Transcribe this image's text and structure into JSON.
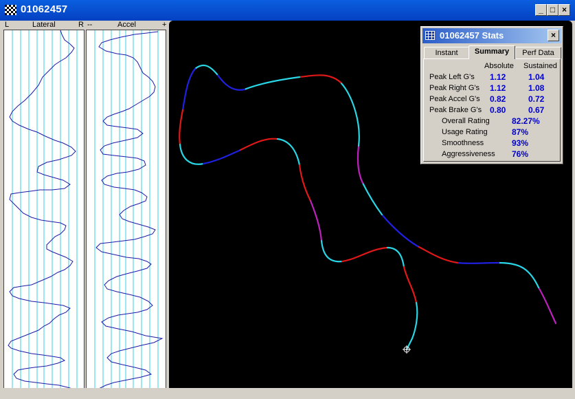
{
  "window": {
    "title": "01062457",
    "minimize_label": "_",
    "maximize_label": "□",
    "close_label": "×"
  },
  "strips": {
    "lateral": {
      "left_label": "L",
      "title": "Lateral",
      "right_label": "R"
    },
    "accel": {
      "left_label": "--",
      "title": "Accel",
      "right_label": "+"
    }
  },
  "stats": {
    "title": "01062457 Stats",
    "close_label": "×",
    "tabs": [
      "Instant",
      "Summary",
      "Perf Data"
    ],
    "active_tab": "Summary",
    "col_absolute": "Absolute",
    "col_sustained": "Sustained",
    "rows": [
      {
        "label": "Peak Left G's",
        "absolute": "1.12",
        "sustained": "1.04"
      },
      {
        "label": "Peak Right G's",
        "absolute": "1.12",
        "sustained": "1.08"
      },
      {
        "label": "Peak Accel G's",
        "absolute": "0.82",
        "sustained": "0.72"
      },
      {
        "label": "Peak Brake G's",
        "absolute": "0.80",
        "sustained": "0.67"
      }
    ],
    "ratings": [
      {
        "label": "Overall Rating",
        "value": "82.27%"
      },
      {
        "label": "Usage Rating",
        "value": "87%"
      },
      {
        "label": "Smoothness",
        "value": "93%"
      },
      {
        "label": "Aggressiveness",
        "value": "76%"
      }
    ]
  },
  "colors": {
    "trace": "#1a1aa8",
    "gridline": "#3ad0e0",
    "track_cyan": "#29d6e6",
    "track_red": "#e01818",
    "track_blue": "#2020e0",
    "track_magenta": "#c020c0"
  },
  "icons": {
    "app": "checkered-flag-icon",
    "stats": "grid-window-icon",
    "position_marker": "crosshair-circle-icon"
  }
}
